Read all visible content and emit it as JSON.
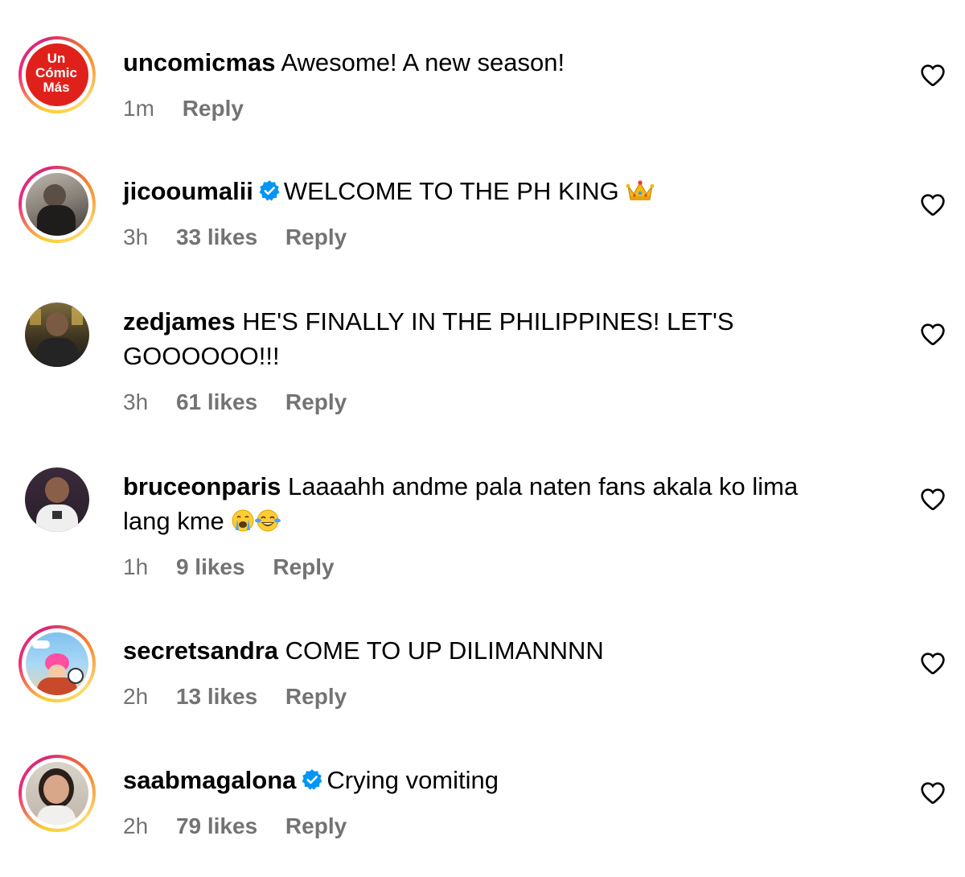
{
  "comments": [
    {
      "username": "uncomicmas",
      "verified": false,
      "text": "Awesome! A new season!",
      "time": "1m",
      "likes": "",
      "reply": "Reply",
      "avatar_logo": [
        "Un",
        "Cómic",
        "Más"
      ]
    },
    {
      "username": "jicooumalii",
      "verified": true,
      "text": "WELCOME TO THE PH KING",
      "emoji": "crown",
      "time": "3h",
      "likes": "33 likes",
      "reply": "Reply"
    },
    {
      "username": "zedjames",
      "verified": false,
      "text": "HE'S FINALLY IN THE PHILIPPINES! LET'S",
      "text_line2": "GOOOOOO!!!",
      "time": "3h",
      "likes": "61 likes",
      "reply": "Reply"
    },
    {
      "username": "bruceonparis",
      "verified": false,
      "text": "Laaaahh andme pala naten fans akala ko lima",
      "text_line2": "lang kme",
      "emoji": [
        "crying-face",
        "tears-of-joy-face"
      ],
      "time": "1h",
      "likes": "9 likes",
      "reply": "Reply"
    },
    {
      "username": "secretsandra",
      "verified": false,
      "text": "COME TO UP DILIMANNNN",
      "time": "2h",
      "likes": "13 likes",
      "reply": "Reply"
    },
    {
      "username": "saabmagalona",
      "verified": true,
      "text": "Crying vomiting",
      "time": "2h",
      "likes": "79 likes",
      "reply": "Reply"
    }
  ],
  "colors": {
    "text": "#000000",
    "meta": "#737373",
    "verified": "#0095f6",
    "uncomicmas_red": "#e0211b"
  }
}
